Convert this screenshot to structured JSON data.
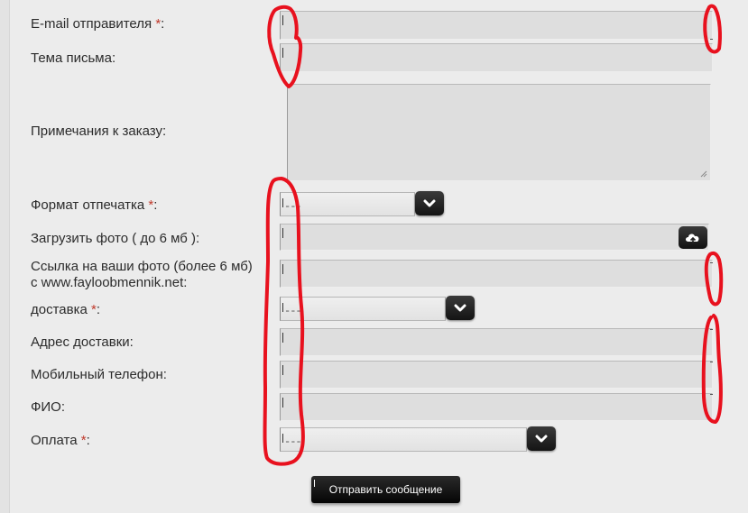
{
  "form": {
    "fields": {
      "email": {
        "label": "E-mail отправителя",
        "required_mark": "*",
        "colon": ":",
        "value": ""
      },
      "subject": {
        "label": "Тема письма:",
        "value": ""
      },
      "notes": {
        "label": "Примечания к заказу:",
        "value": ""
      },
      "print_format": {
        "label": "Формат отпечатка",
        "required_mark": "*",
        "colon": ":",
        "selected": "---"
      },
      "upload": {
        "label": "Загрузить фото ( до 6 мб ):",
        "icon": "cloud-upload-icon"
      },
      "photo_link": {
        "label_line1": "Ссылка на ваши фото (более 6 мб)",
        "label_line2": "с www.fayloobmennik.net:",
        "value": ""
      },
      "delivery": {
        "label": "доставка",
        "required_mark": "*",
        "colon": ":",
        "selected": "---"
      },
      "address": {
        "label": "Адрес доставки:",
        "value": ""
      },
      "phone": {
        "label": "Мобильный телефон:",
        "value": ""
      },
      "name": {
        "label": "ФИО:",
        "value": ""
      },
      "payment": {
        "label": "Оплата",
        "required_mark": "*",
        "colon": ":",
        "selected": "---"
      }
    },
    "submit_label": "Отправить сообщение"
  },
  "colors": {
    "background": "#ececec",
    "field_background": "#dedede",
    "required": "#c0392b",
    "annotation_ink": "#e8111e",
    "button_dark": "#141414"
  }
}
